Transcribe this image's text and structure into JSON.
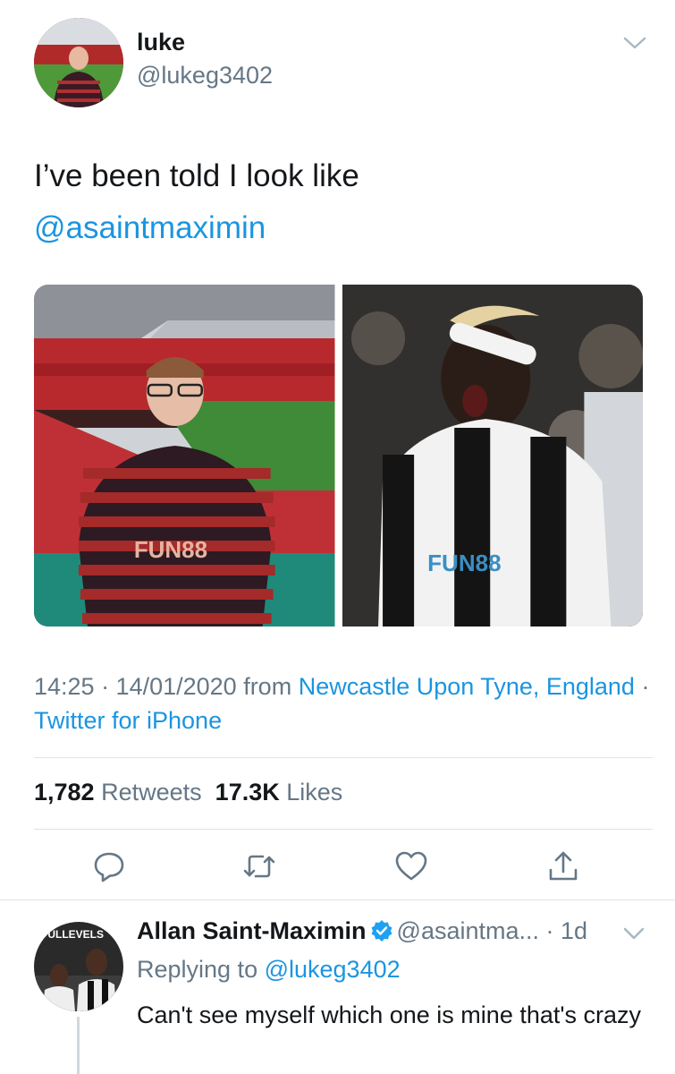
{
  "tweet": {
    "author_name": "luke",
    "author_handle": "@lukeg3402",
    "text": "I’ve been told I look like",
    "mention": "@asaintmaximin",
    "time": "14:25 · 14/01/2020 from ",
    "location": "Newcastle Upon Tyne, England",
    "separator": " · ",
    "source": "Twitter for iPhone",
    "retweets_count": "1,782",
    "retweets_label": "Retweets",
    "likes_count": "17.3K",
    "likes_label": "Likes",
    "photo_left_shirt_text": "FUN88",
    "photo_right_shirt_text": "FUN88"
  },
  "actions": [
    {
      "icon": "reply-icon"
    },
    {
      "icon": "retweet-icon"
    },
    {
      "icon": "like-icon"
    },
    {
      "icon": "share-icon"
    }
  ],
  "reply": {
    "author_name": "Allan Saint-Maximin",
    "author_handle": "@asaintma...",
    "age": " · 1d",
    "replying_prefix": "Replying to ",
    "replying_to": "@lukeg3402",
    "text": "Can't see myself which one is mine that's crazy",
    "avatar_text": "FULLEVELS"
  },
  "colors": {
    "link": "#1b95e0",
    "secondary": "#657786",
    "primary": "#14171a",
    "verified": "#1da1f2"
  }
}
